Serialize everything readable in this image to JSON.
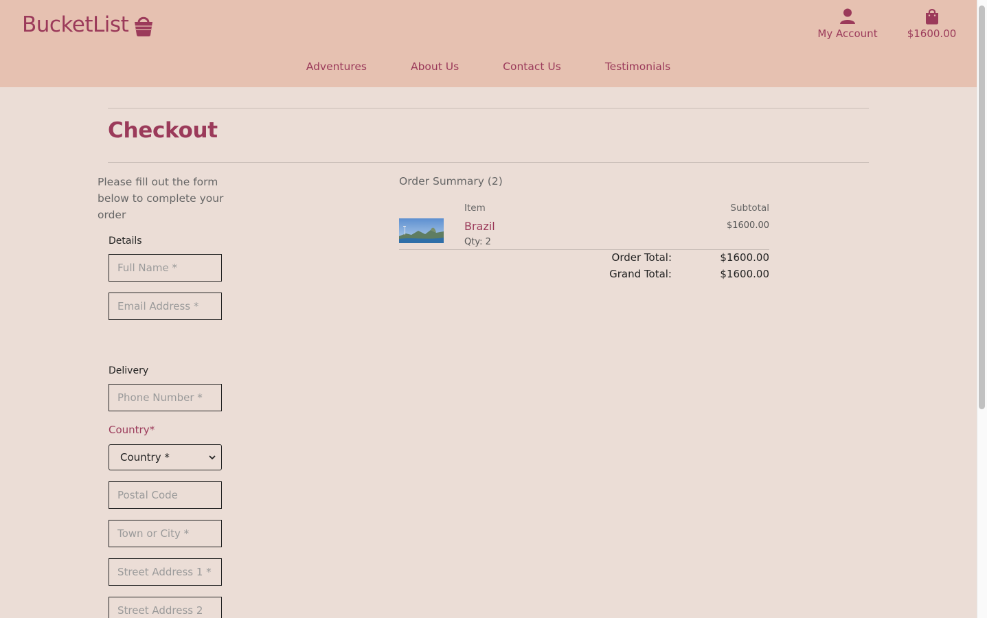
{
  "brand": {
    "name": "BucketList"
  },
  "header": {
    "account_label": "My Account",
    "bag_total": "$1600.00",
    "nav": [
      "Adventures",
      "About Us",
      "Contact Us",
      "Testimonials"
    ]
  },
  "page": {
    "title": "Checkout",
    "intro": "Please fill out the form below to complete your order"
  },
  "form": {
    "details_label": "Details",
    "full_name_placeholder": "Full Name *",
    "email_placeholder": "Email Address *",
    "delivery_label": "Delivery",
    "phone_placeholder": "Phone Number *",
    "country_label": "Country*",
    "country_selected": "Country *",
    "postal_placeholder": "Postal Code",
    "town_placeholder": "Town or City *",
    "street1_placeholder": "Street Address 1 *",
    "street2_placeholder": "Street Address 2"
  },
  "summary": {
    "title": "Order Summary (2)",
    "col_item": "Item",
    "col_subtotal": "Subtotal",
    "items": [
      {
        "name": "Brazil",
        "qty": "Qty: 2",
        "subtotal": "$1600.00"
      }
    ],
    "order_total_label": "Order Total:",
    "order_total": "$1600.00",
    "grand_total_label": "Grand Total:",
    "grand_total": "$1600.00"
  },
  "colors": {
    "accent": "#9b3a5a",
    "header_bg": "#e6c1b1",
    "page_bg": "#ebddd6"
  },
  "icons": [
    "basket-icon",
    "user-icon",
    "shopping-bag-icon",
    "chevron-down-icon"
  ]
}
